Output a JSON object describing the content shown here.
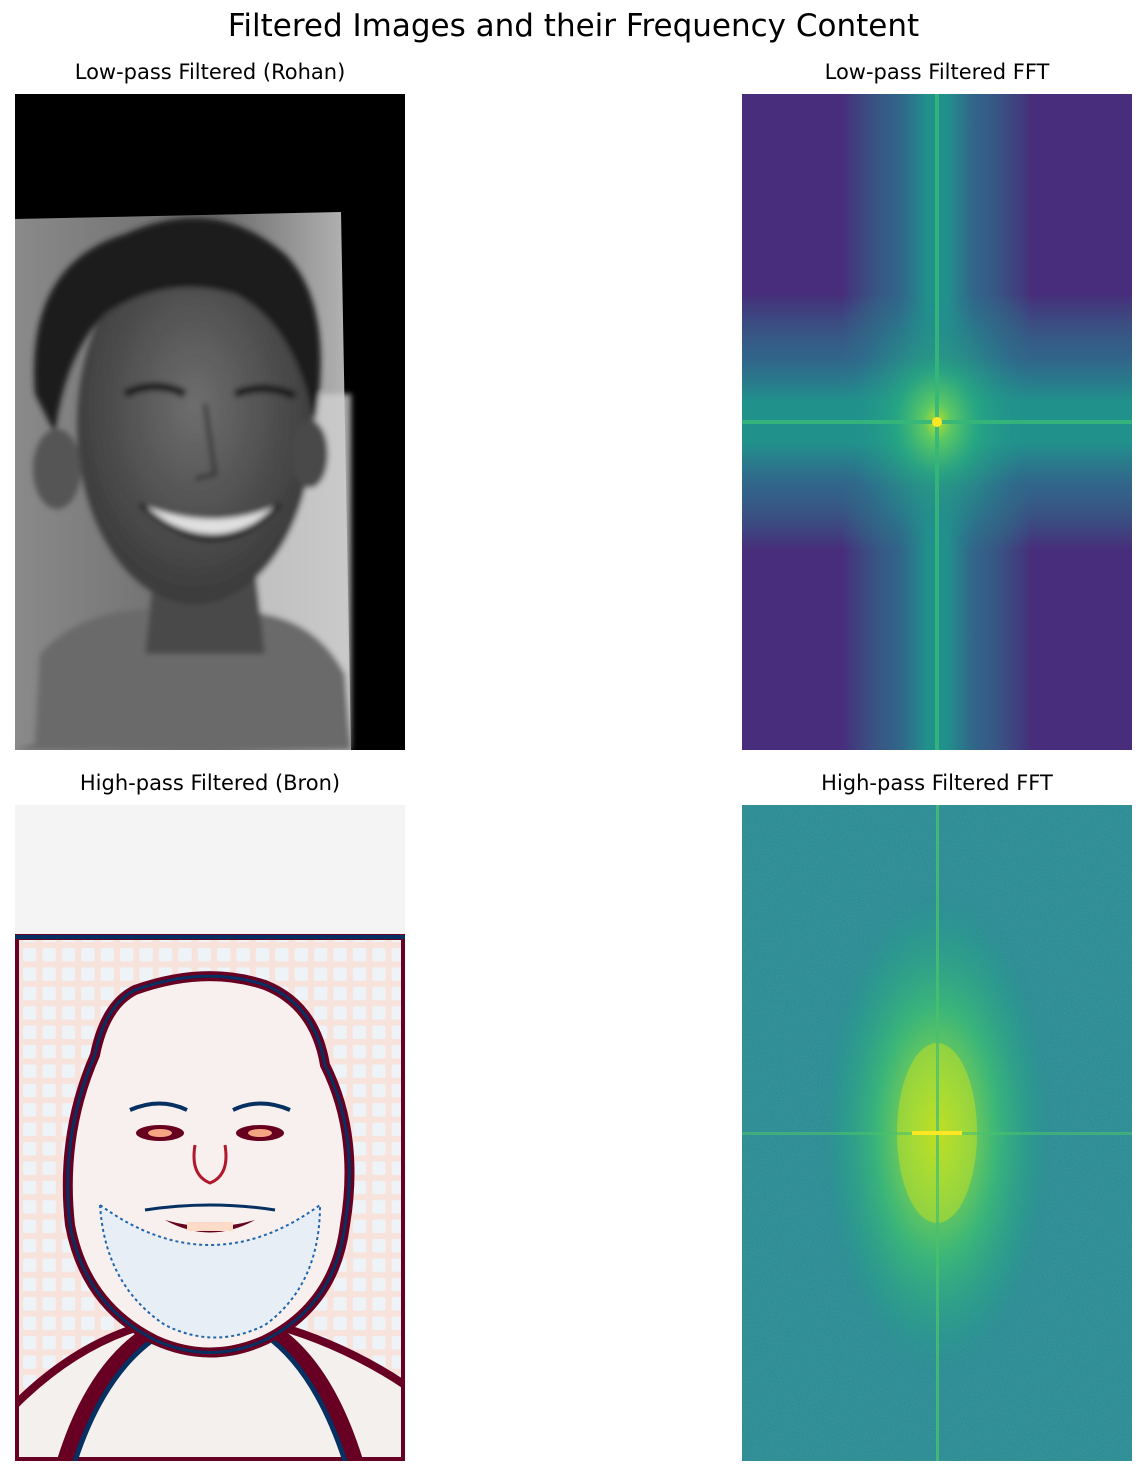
{
  "figure": {
    "title": "Filtered Images and their Frequency Content"
  },
  "chart_data": [
    {
      "type": "image",
      "title": "Low-pass Filtered (Rohan)",
      "colormap": "gray",
      "axes": "off",
      "content": "grayscale photo of a smiling young man with curly hair, blurred"
    },
    {
      "type": "heatmap",
      "title": "Low-pass Filtered FFT",
      "colormap": "viridis",
      "axes": "off",
      "content": "log-magnitude spectrum with bright center and cross-shaped streaks"
    },
    {
      "type": "image",
      "title": "High-pass Filtered (Bron)",
      "colormap": "RdBu",
      "axes": "off",
      "content": "edge-enhanced photo of a bearded man in front of a tiled backdrop"
    },
    {
      "type": "heatmap",
      "title": "High-pass Filtered FFT",
      "colormap": "viridis",
      "axes": "off",
      "content": "noisy spectrum with bright elongated central blob and faint cross"
    }
  ]
}
